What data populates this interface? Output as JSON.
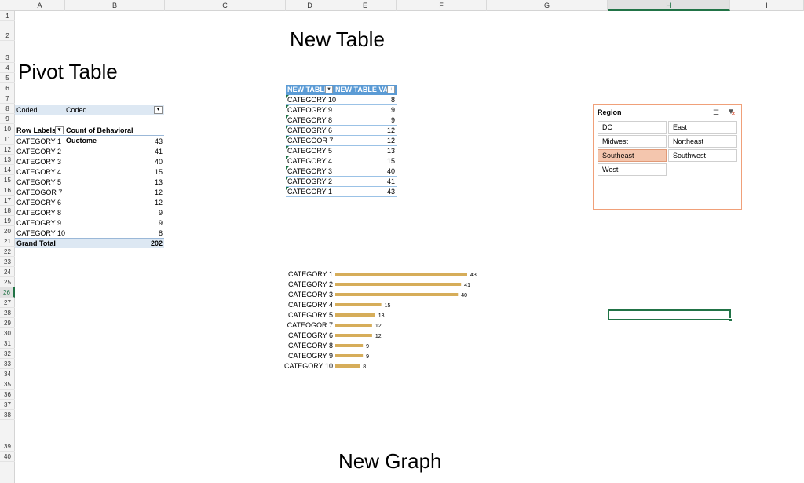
{
  "columns": [
    "A",
    "B",
    "C",
    "D",
    "E",
    "F",
    "G",
    "H",
    "I"
  ],
  "selected_column": "H",
  "rows": [
    "1",
    "2",
    "3",
    "4",
    "5",
    "6",
    "7",
    "8",
    "9",
    "10",
    "11",
    "12",
    "13",
    "14",
    "15",
    "16",
    "17",
    "18",
    "19",
    "20",
    "21",
    "22",
    "23",
    "24",
    "25",
    "26",
    "27",
    "28",
    "29",
    "30",
    "31",
    "32",
    "33",
    "34",
    "35",
    "36",
    "37",
    "38",
    "39",
    "40"
  ],
  "selected_row": "26",
  "titles": {
    "pivot": "Pivot Table",
    "new_table": "New Table",
    "new_graph": "New Graph"
  },
  "pivot": {
    "filter_label": "Coded",
    "filter_value": "Coded",
    "header_row": "Row Labels",
    "header_count": "Count of Behavioral Ouctome",
    "rows": [
      {
        "label": "CATEGORY 1",
        "value": "43"
      },
      {
        "label": "CATEGORY 2",
        "value": "41"
      },
      {
        "label": "CATEGORY 3",
        "value": "40"
      },
      {
        "label": "CATEGORY 4",
        "value": "15"
      },
      {
        "label": "CATEGORY 5",
        "value": "13"
      },
      {
        "label": "CATEOGOR 7",
        "value": "12"
      },
      {
        "label": "CATEOGRY 6",
        "value": "12"
      },
      {
        "label": "CATEGORY 8",
        "value": "9"
      },
      {
        "label": "CATEOGRY 9",
        "value": "9"
      },
      {
        "label": "CATEGORY 10",
        "value": "8"
      }
    ],
    "grand_total_label": "Grand Total",
    "grand_total_value": "202"
  },
  "new_table": {
    "header1": "NEW TABLE",
    "header2": "NEW TABLE VALUE",
    "rows": [
      {
        "label": "CATEGORY 10",
        "value": "8"
      },
      {
        "label": "CATEOGRY 9",
        "value": "9"
      },
      {
        "label": "CATEGORY 8",
        "value": "9"
      },
      {
        "label": "CATEOGRY 6",
        "value": "12"
      },
      {
        "label": "CATEGOOR 7",
        "value": "12"
      },
      {
        "label": "CATEGORY 5",
        "value": "13"
      },
      {
        "label": "CATEGORY 4",
        "value": "15"
      },
      {
        "label": "CATEGORY 3",
        "value": "40"
      },
      {
        "label": "CATEOGRY 2",
        "value": "41"
      },
      {
        "label": "CATEGORY 1",
        "value": "43"
      }
    ]
  },
  "slicer": {
    "title": "Region",
    "items": [
      {
        "label": "DC",
        "selected": false
      },
      {
        "label": "East",
        "selected": false
      },
      {
        "label": "Midwest",
        "selected": false
      },
      {
        "label": "Northeast",
        "selected": false
      },
      {
        "label": "Southeast",
        "selected": true
      },
      {
        "label": "Southwest",
        "selected": false
      },
      {
        "label": "West",
        "selected": false
      }
    ],
    "multi_select_icon": "multi-select-icon",
    "clear_filter_icon": "clear-filter-icon"
  },
  "colors": {
    "bar": "#d6ad5a",
    "table_header": "#5b9bd5",
    "pivot_band": "#dde8f3",
    "slicer_border": "#f0a079",
    "slicer_selected": "#f4c6ae",
    "selection": "#217346"
  },
  "chart_data": {
    "type": "bar",
    "orientation": "horizontal",
    "categories": [
      "CATEGORY 1",
      "CATEGORY 2",
      "CATEGORY 3",
      "CATEGORY 4",
      "CATEGORY 5",
      "CATEOGOR 7",
      "CATEOGRY 6",
      "CATEGORY 8",
      "CATEOGRY 9",
      "CATEGORY 10"
    ],
    "values": [
      43,
      41,
      40,
      15,
      13,
      12,
      12,
      9,
      9,
      8
    ],
    "data_labels": true,
    "grid": false,
    "title": "",
    "xlabel": "",
    "ylabel": ""
  }
}
